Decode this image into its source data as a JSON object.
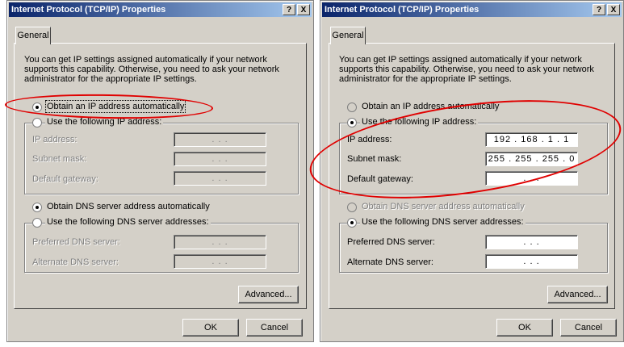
{
  "left": {
    "title": "Internet Protocol (TCP/IP) Properties",
    "help_label": "?",
    "close_label": "X",
    "tab_label": "General",
    "intro": "You can get IP settings assigned automatically if your network supports this capability. Otherwise, you need to ask your network administrator for the appropriate IP settings.",
    "radio_auto_ip": "Obtain an IP address automatically",
    "radio_static_ip": "Use the following IP address:",
    "ip_label": "IP address:",
    "ip_value": ". . .",
    "subnet_label": "Subnet mask:",
    "subnet_value": ". . .",
    "gateway_label": "Default gateway:",
    "gateway_value": ". . .",
    "radio_auto_dns": "Obtain DNS server address automatically",
    "radio_static_dns": "Use the following DNS server addresses:",
    "pref_dns_label": "Preferred DNS server:",
    "pref_dns_value": ". . .",
    "alt_dns_label": "Alternate DNS server:",
    "alt_dns_value": ". . .",
    "advanced_label": "Advanced...",
    "ok_label": "OK",
    "cancel_label": "Cancel"
  },
  "right": {
    "title": "Internet Protocol (TCP/IP) Properties",
    "help_label": "?",
    "close_label": "X",
    "tab_label": "General",
    "intro": "You can get IP settings assigned automatically if your network supports this capability. Otherwise, you need to ask your network administrator for the appropriate IP settings.",
    "radio_auto_ip": "Obtain an IP address automatically",
    "radio_static_ip": "Use the following IP address:",
    "ip_label": "IP address:",
    "ip_value": "192 . 168 . 1 . 1",
    "subnet_label": "Subnet mask:",
    "subnet_value": "255 . 255 . 255 . 0",
    "gateway_label": "Default gateway:",
    "gateway_value": ". . .",
    "radio_auto_dns": "Obtain DNS server address automatically",
    "radio_static_dns": "Use the following DNS server addresses:",
    "pref_dns_label": "Preferred DNS server:",
    "pref_dns_value": ". . .",
    "alt_dns_label": "Alternate DNS server:",
    "alt_dns_value": ". . .",
    "advanced_label": "Advanced...",
    "ok_label": "OK",
    "cancel_label": "Cancel"
  },
  "colors": {
    "annotation": "#e00000",
    "titlebar_start": "#0a246a",
    "titlebar_end": "#a6caf0",
    "dialog_bg": "#d4d0c8"
  }
}
